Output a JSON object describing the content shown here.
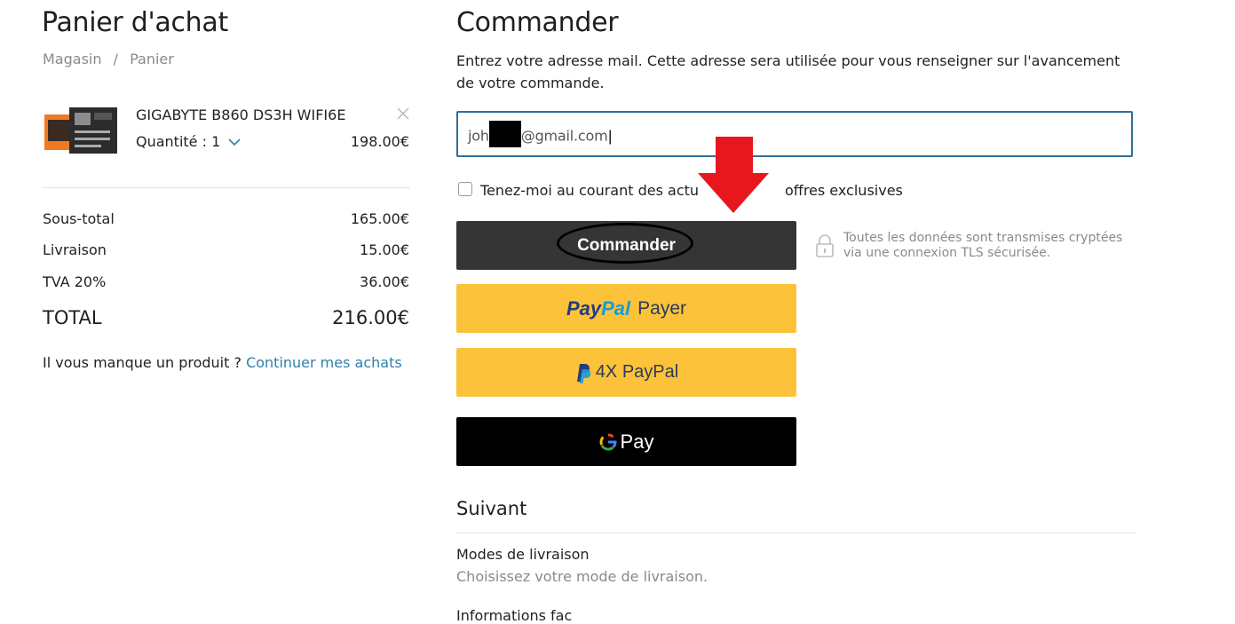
{
  "cart": {
    "title": "Panier d'achat",
    "breadcrumb": [
      "Magasin",
      "/",
      "Panier"
    ],
    "item": {
      "name": "GIGABYTE B860 DS3H WIFI6E",
      "quantity_label": "Quantité : 1",
      "price": "198.00€"
    },
    "subtotal_label": "Sous-total",
    "subtotal": "165.00€",
    "shipping_label": "Livraison",
    "shipping": "15.00€",
    "vat_label": "TVA 20%",
    "vat": "36.00€",
    "total_label": "TOTAL",
    "total": "216.00€",
    "missing_text": "Il vous manque un produit ?",
    "continue_link": "Continuer mes achats"
  },
  "checkout": {
    "title": "Commander",
    "intro": "Entrez votre adresse mail. Cette adresse sera utilisée pour vous renseigner sur l'avancement de votre commande.",
    "email_prefix": "joh",
    "email_suffix": "@gmail.com",
    "newsletter_label_start": "Tenez-moi au courant des actu",
    "newsletter_label_end": "offres exclusives",
    "commander_button": "Commander",
    "tls_note": "Toutes les données sont transmises cryptées via une connexion TLS sécurisée.",
    "paypal_logo_a": "Pay",
    "paypal_logo_b": "Pal",
    "paypal_button": "Payer",
    "paypal4x_button": "4X PayPal",
    "gpay_button": "Pay",
    "next_title": "Suivant",
    "delivery_title": "Modes de livraison",
    "delivery_sub": "Choisissez votre mode de livraison.",
    "cut_text": "Informations fac"
  },
  "colors": {
    "link": "#2f7fae",
    "paypal_yellow": "#fcc33a",
    "annotation_arrow": "#e8161f"
  }
}
